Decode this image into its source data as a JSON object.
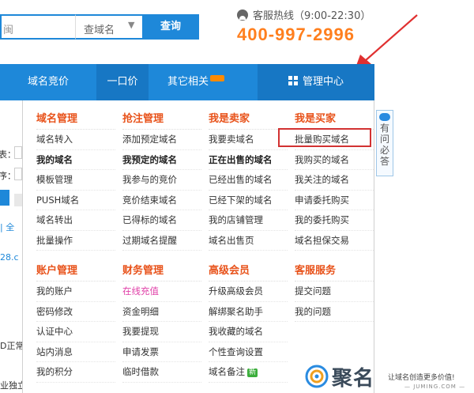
{
  "search": {
    "input_text": "闽",
    "select_label": "查域名",
    "button_label": "查询"
  },
  "hotline": {
    "label": "客服热线（9:00-22:30）",
    "number": "400-997-2996"
  },
  "nav": {
    "items": [
      {
        "label": "域名竞价"
      },
      {
        "label": "一口价"
      },
      {
        "label": "其它相关"
      },
      {
        "label": "管理中心"
      }
    ]
  },
  "columns": [
    {
      "title": "域名管理",
      "items": [
        "域名转入",
        "我的域名",
        "模板管理",
        "PUSH域名",
        "域名转出",
        "批量操作"
      ]
    },
    {
      "title": "抢注管理",
      "items": [
        "添加预定域名",
        "我预定的域名",
        "我参与的竞价",
        "竞价结束域名",
        "已得标的域名",
        "过期域名提醒"
      ]
    },
    {
      "title": "我是卖家",
      "items": [
        "我要卖域名",
        "正在出售的域名",
        "已经出售的域名",
        "已经下架的域名",
        "我的店铺管理",
        "域名出售页"
      ]
    },
    {
      "title": "我是买家",
      "items": [
        "批量购买域名",
        "我购买的域名",
        "我关注的域名",
        "申请委托购买",
        "我的委托购买",
        "域名担保交易"
      ]
    },
    {
      "title": "账户管理",
      "items": [
        "我的账户",
        "密码修改",
        "认证中心",
        "站内消息",
        "我的积分"
      ]
    },
    {
      "title": "财务管理",
      "items": [
        "在线充值",
        "资金明细",
        "我要提现",
        "申请发票",
        "临时借款"
      ]
    },
    {
      "title": "高级会员",
      "items": [
        "升级高级会员",
        "解绑聚名助手",
        "我收藏的域名",
        "个性查询设置",
        "域名备注"
      ]
    },
    {
      "title": "客服服务",
      "items": [
        "提交问题",
        "我的问题"
      ]
    }
  ],
  "new_badge": "新",
  "left_partial": [
    "表：",
    "序：",
    "| 全",
    "28.c",
    "D正常",
    "业独立"
  ],
  "help_tab": [
    "有",
    "问",
    "必",
    "答"
  ],
  "watermark": {
    "brand": "聚名",
    "slogan": "让域名创造更多价值!",
    "url": "— JUMING.COM —"
  },
  "colors": {
    "primary_blue": "#1e88d9",
    "hotline_orange": "#ff7f1e",
    "section_title": "#e8521a",
    "highlight_red": "#d23232"
  }
}
